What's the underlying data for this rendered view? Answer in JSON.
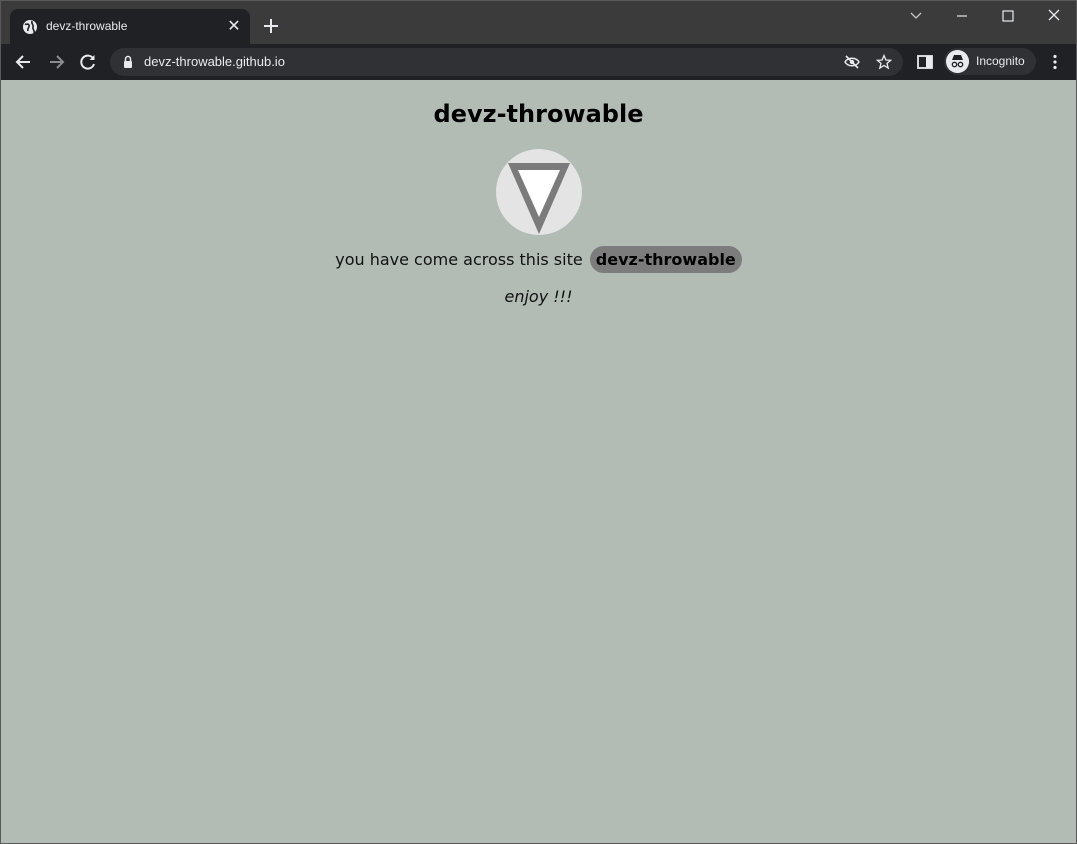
{
  "browser": {
    "tab": {
      "title": "devz-throwable"
    },
    "url": "devz-throwable.github.io",
    "profile_label": "Incognito"
  },
  "page": {
    "title": "devz-throwable",
    "intro_text": "you have come across this site",
    "site_badge": "devz-throwable",
    "enjoy_text": "enjoy !!!"
  },
  "colors": {
    "page_background": "#b2bcb4",
    "badge_background": "#7c7c7c",
    "logo_circle": "#e4e4e4",
    "logo_triangle": "#7b7b7b"
  }
}
